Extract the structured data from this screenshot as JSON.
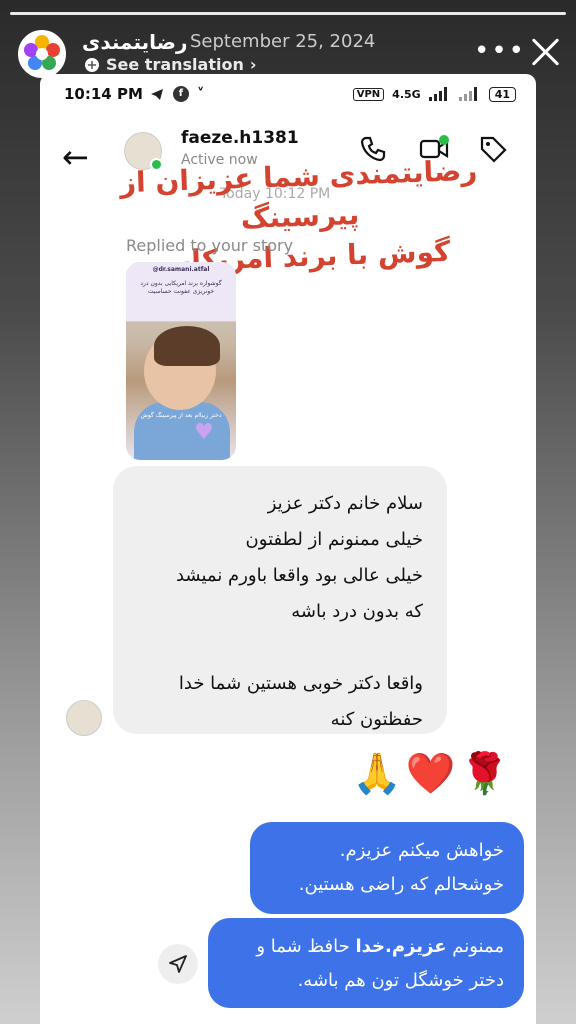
{
  "story": {
    "username": "رضایتمندی",
    "date": "September 25, 2024",
    "see_translation": "See translation",
    "more": "•••"
  },
  "phone_status": {
    "time": "10:14 PM",
    "vpn": "VPN",
    "network": "4.5G",
    "battery": "41"
  },
  "chat": {
    "name": "faeze.h1381",
    "status": "Active now",
    "today": "Today 10:12 PM",
    "replied": "Replied to your story",
    "overlay_caption_line1": "رضایتمندی شما عزیزان از پیرسینگ",
    "overlay_caption_line2": "گوش  با برند امریکایی",
    "thumb_handle": "@dr.samani.atfal",
    "thumb_text": "گوشواره برند امریکایی بدون درد خونریزی عفونت حساسیت",
    "thumb_caption": "دختر زیبا‌ام بعد از پیرسینگ گوش",
    "incoming_message": "سلام خانم دکتر عزیز\nخیلی ممنونم از لطفتون\nخیلی عالی بود واقعا باورم نمیشد\nکه بدون درد باشه\n\nواقعا دکتر خوبی هستین شما خدا\nحفظتون کنه",
    "reactions": "🙏❤️🌹",
    "outgoing_message_1": "خواهش میکنم عزیزم.\nخوشحالم که راضی هستین.",
    "outgoing_message_2_prefix": "ممنونم ",
    "outgoing_message_2_bold": "عزیزم.خدا",
    "outgoing_message_2_rest": " حافظ شما و\nدختر خوشگل تون هم باشه."
  },
  "colors": {
    "caption": "#d3432f",
    "outgoing_bubble": "#3d72e8",
    "incoming_bubble": "#efefef",
    "online": "#2bbd48"
  }
}
